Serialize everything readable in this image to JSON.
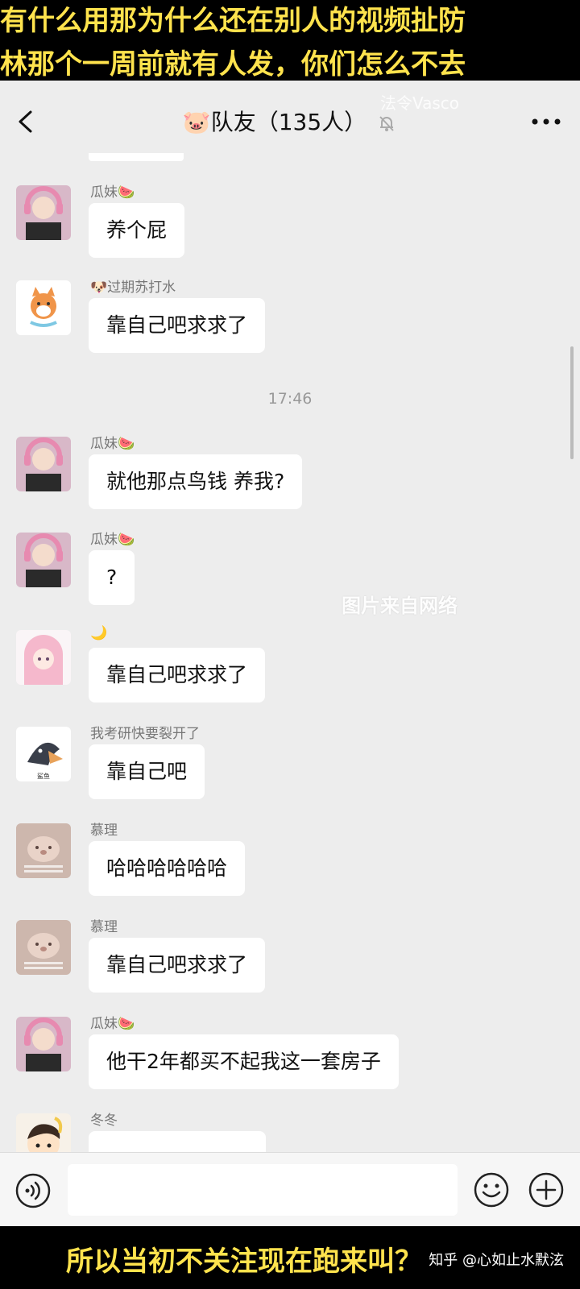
{
  "captions": {
    "top_line1": "有什么用那为什么还在别人的视频扯防",
    "top_line2": "林那个一周前就有人发，你们怎么不去",
    "bottom": "所以当初不关注现在跑来叫？",
    "credit": "知乎 @心如止水默泫"
  },
  "watermarks": {
    "top": "法令Vasco",
    "middle": "图片来自网络"
  },
  "header": {
    "title_emoji": "🐷",
    "title": "队友（135人）",
    "back_icon": "chevron-left-icon",
    "mute_icon": "bell-slash-icon",
    "more_icon": "ellipsis-icon"
  },
  "chat": {
    "time_separator": "17:46",
    "messages": [
      {
        "sender": "瓜妹🍉",
        "text": "养个屁",
        "avatar": "avatar-headphones-girl"
      },
      {
        "sender": "🐶过期苏打水",
        "text": "靠自己吧求求了",
        "avatar": "avatar-shiba"
      },
      {
        "sender": "瓜妹🍉",
        "text": "就他那点鸟钱 养我?",
        "avatar": "avatar-headphones-girl"
      },
      {
        "sender": "瓜妹🍉",
        "text": "?",
        "avatar": "avatar-headphones-girl"
      },
      {
        "sender": "🌙",
        "text": "靠自己吧求求了",
        "avatar": "avatar-pink-anime"
      },
      {
        "sender": "我考研快要裂开了",
        "text": "靠自己吧",
        "avatar": "avatar-shark"
      },
      {
        "sender": "慕理",
        "text": "哈哈哈哈哈哈",
        "avatar": "avatar-bear"
      },
      {
        "sender": "慕理",
        "text": "靠自己吧求求了",
        "avatar": "avatar-bear"
      },
      {
        "sender": "瓜妹🍉",
        "text": "他干2年都买不起我这一套房子",
        "avatar": "avatar-headphones-girl"
      },
      {
        "sender": "冬冬",
        "text": "",
        "avatar": "avatar-cartoon-boy"
      }
    ]
  },
  "input_bar": {
    "voice_icon": "voice-icon",
    "emoji_icon": "emoji-icon",
    "plus_icon": "plus-circle-icon",
    "placeholder": ""
  },
  "colors": {
    "caption_text": "#ffe34d",
    "caption_bg": "#000000",
    "chat_bg": "#ededed",
    "bubble_bg": "#ffffff"
  }
}
